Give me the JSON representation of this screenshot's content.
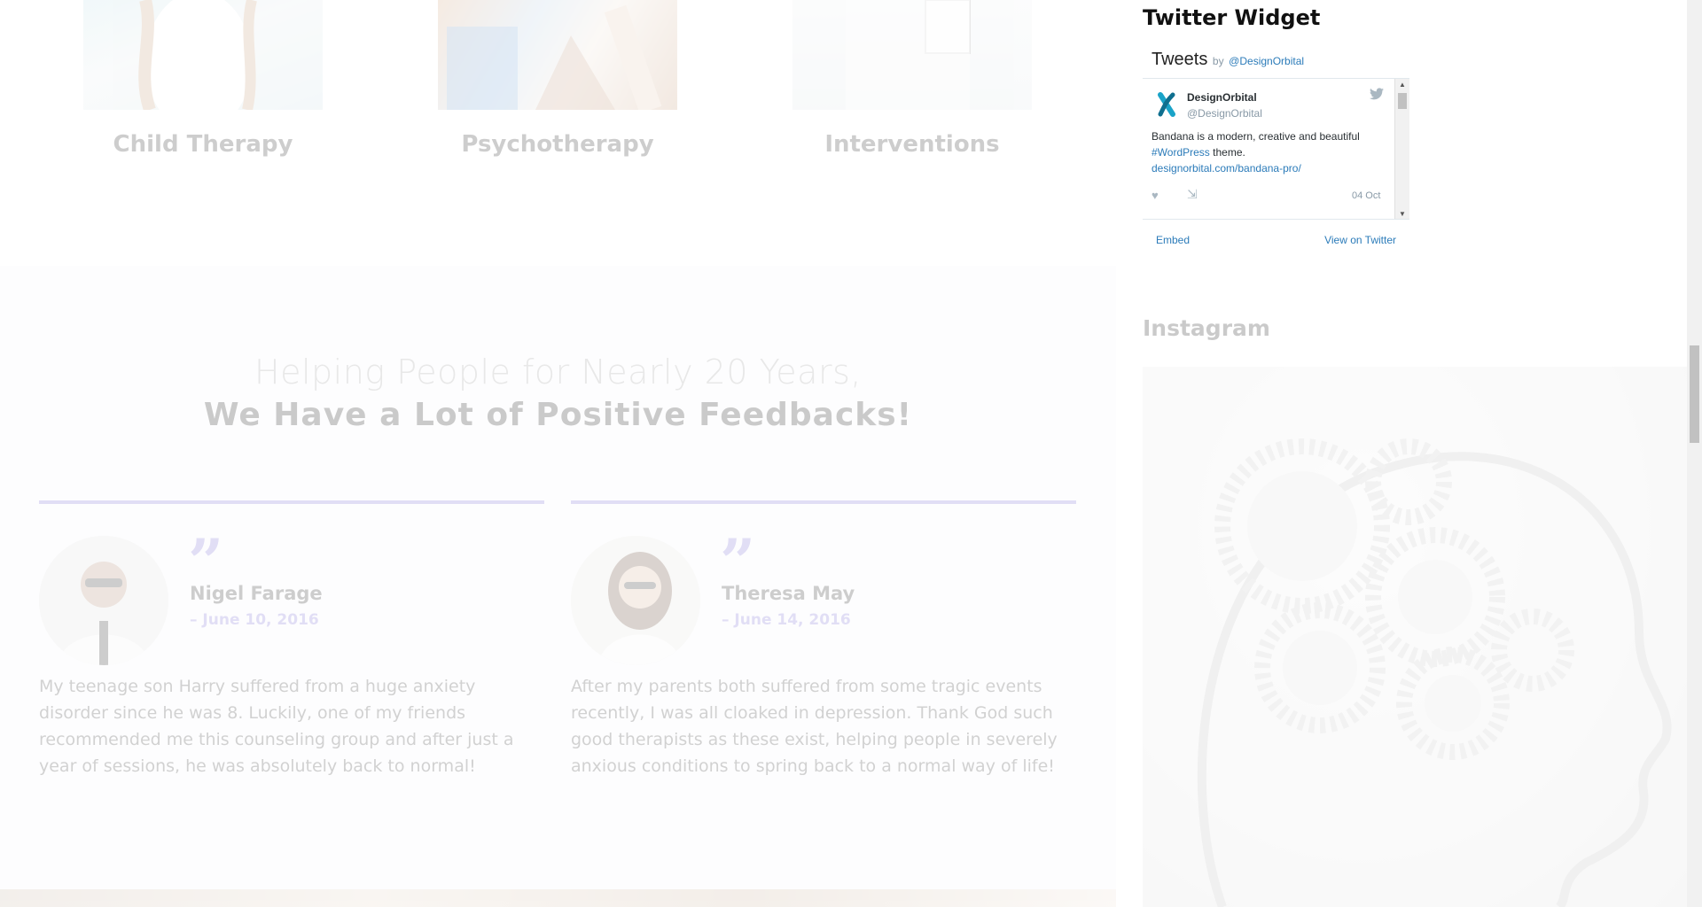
{
  "services": [
    {
      "title": "Child Therapy"
    },
    {
      "title": "Psychotherapy"
    },
    {
      "title": "Interventions"
    }
  ],
  "feedback": {
    "heading_light": "Helping People for Nearly 20 Years,",
    "heading_bold": "We Have a Lot of Positive Feedbacks!",
    "testimonials": [
      {
        "name": "Nigel Farage",
        "date": "– June 10, 2016",
        "text": "My teenage son Harry suffered from a huge anxiety disorder since he was 8. Luckily, one of my friends recommended me this counseling group and after just a year of sessions, he was absolutely back to normal!"
      },
      {
        "name": "Theresa May",
        "date": "– June 14, 2016",
        "text": "After my parents both suffered from some tragic events recently, I was all cloaked in depression. Thank God such good therapists as these exist, helping people in severely anxious conditions to spring back to a normal way of life!"
      }
    ],
    "accent_color": "#7b6fd6"
  },
  "sidebar": {
    "twitter": {
      "widget_title": "Twitter Widget",
      "header_title": "Tweets",
      "header_by": "by",
      "header_handle": "@DesignOrbital",
      "tweet": {
        "name": "DesignOrbital",
        "handle": "@DesignOrbital",
        "text_line1": "Bandana is a modern, creative and beautiful",
        "hashtag": "#WordPress",
        "text_after_hashtag": "theme.",
        "link": "designorbital.com/bandana-pro/",
        "date": "04 Oct"
      },
      "footer_embed": "Embed",
      "footer_view": "View on Twitter",
      "link_color": "#2b7bb9"
    },
    "instagram": {
      "title": "Instagram"
    }
  }
}
